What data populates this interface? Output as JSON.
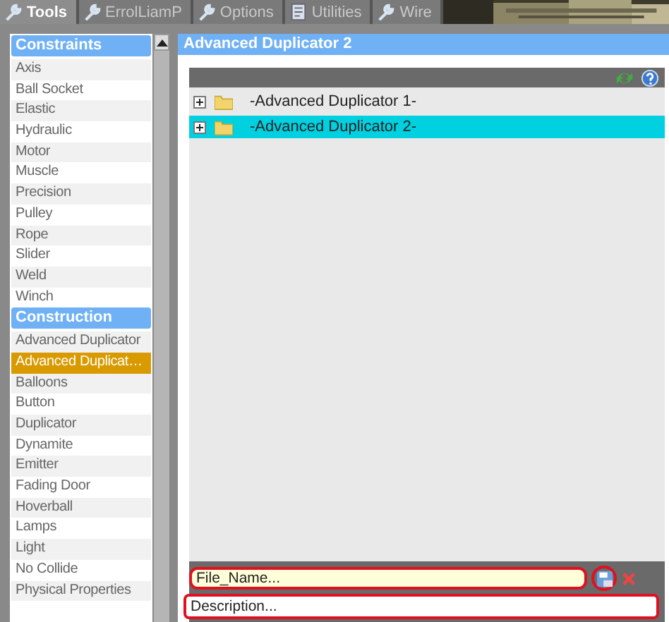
{
  "tabs": [
    {
      "label": "Tools",
      "selected": true,
      "kind": "wrench"
    },
    {
      "label": "ErrolLiamP",
      "selected": false,
      "kind": "wrench"
    },
    {
      "label": "Options",
      "selected": false,
      "kind": "wrench"
    },
    {
      "label": "Utilities",
      "selected": false,
      "kind": "page"
    },
    {
      "label": "Wire",
      "selected": false,
      "kind": "wrench"
    }
  ],
  "sidebar": {
    "sections": [
      {
        "title": "Constraints",
        "items": [
          {
            "label": "Axis",
            "selected": false
          },
          {
            "label": "Ball Socket",
            "selected": false
          },
          {
            "label": "Elastic",
            "selected": false
          },
          {
            "label": "Hydraulic",
            "selected": false
          },
          {
            "label": "Motor",
            "selected": false
          },
          {
            "label": "Muscle",
            "selected": false
          },
          {
            "label": "Precision",
            "selected": false
          },
          {
            "label": "Pulley",
            "selected": false
          },
          {
            "label": "Rope",
            "selected": false
          },
          {
            "label": "Slider",
            "selected": false
          },
          {
            "label": "Weld",
            "selected": false
          },
          {
            "label": "Winch",
            "selected": false
          }
        ]
      },
      {
        "title": "Construction",
        "items": [
          {
            "label": "Advanced Duplicator",
            "selected": false
          },
          {
            "label": "Advanced Duplicat…",
            "selected": true
          },
          {
            "label": "Balloons",
            "selected": false
          },
          {
            "label": "Button",
            "selected": false
          },
          {
            "label": "Duplicator",
            "selected": false
          },
          {
            "label": "Dynamite",
            "selected": false
          },
          {
            "label": "Emitter",
            "selected": false
          },
          {
            "label": "Fading Door",
            "selected": false
          },
          {
            "label": "Hoverball",
            "selected": false
          },
          {
            "label": "Lamps",
            "selected": false
          },
          {
            "label": "Light",
            "selected": false
          },
          {
            "label": "No Collide",
            "selected": false
          },
          {
            "label": "Physical Properties",
            "selected": false
          }
        ]
      }
    ]
  },
  "panel": {
    "title": "Advanced Duplicator 2",
    "files": [
      {
        "label": "-Advanced Duplicator 1-",
        "selected": false,
        "expanded": false
      },
      {
        "label": "-Advanced Duplicator 2-",
        "selected": true,
        "expanded": false
      }
    ],
    "file_name": {
      "placeholder": "File_Name...",
      "highlighted": true
    },
    "save_highlighted": true,
    "description": {
      "placeholder": "Description...",
      "highlighted": true
    }
  }
}
